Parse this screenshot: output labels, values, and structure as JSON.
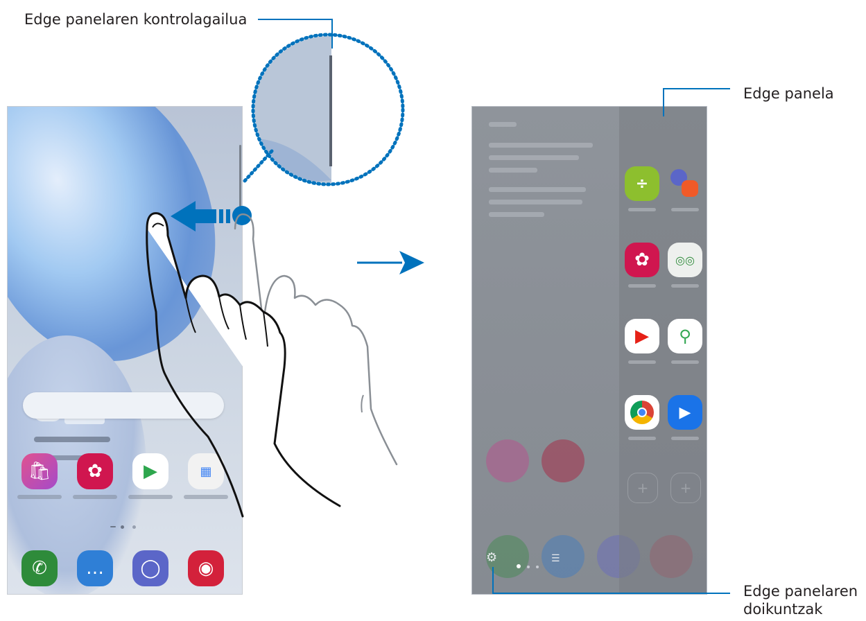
{
  "callouts": {
    "handle_label": "Edge panelaren kontrolagailua",
    "panel_label": "Edge panela",
    "settings_label_line1": "Edge panelaren",
    "settings_label_line2": "doikuntzak"
  },
  "colors": {
    "callout_line": "#0072bc",
    "arrow": "#0072bc",
    "magnifier_dots": "#0072bc"
  },
  "left_phone": {
    "home_apps": [
      {
        "icon": "shopping-bag-icon",
        "color": "#c14fb0"
      },
      {
        "icon": "gallery-flower-icon",
        "color": "#d0164f"
      },
      {
        "icon": "play-store-icon",
        "color": "#ffffff"
      },
      {
        "icon": "google-folder-icon",
        "color": "#f2f2f2"
      }
    ],
    "dock_apps": [
      {
        "icon": "phone-icon",
        "color": "#2e8b3a"
      },
      {
        "icon": "messages-icon",
        "color": "#2f7fd6"
      },
      {
        "icon": "internet-icon",
        "color": "#5b66c8"
      },
      {
        "icon": "camera-icon",
        "color": "#d3213b"
      }
    ]
  },
  "right_phone": {
    "panel_apps": [
      {
        "icon": "calculator-icon",
        "color": "#8dbf2e"
      },
      {
        "icon": "app-pair-icon",
        "color": "#e8eaf6"
      },
      {
        "icon": "gallery-flower-icon",
        "color": "#d0164f"
      },
      {
        "icon": "bixby-vision-icon",
        "color": "#eef0ee"
      },
      {
        "icon": "youtube-icon",
        "color": "#ffffff"
      },
      {
        "icon": "maps-icon",
        "color": "#ffffff"
      },
      {
        "icon": "chrome-icon",
        "color": "#ffffff"
      },
      {
        "icon": "video-call-icon",
        "color": "#1a73e8"
      }
    ],
    "add_slots": 2
  }
}
